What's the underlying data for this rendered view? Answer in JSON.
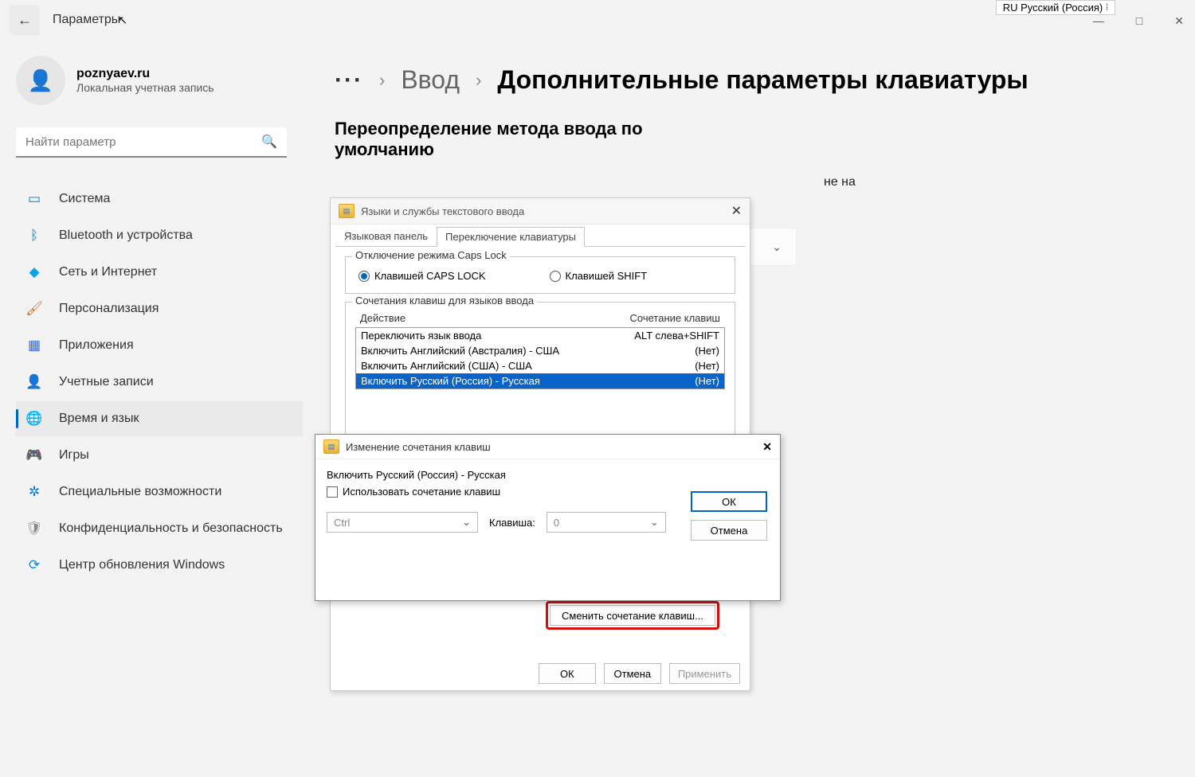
{
  "window": {
    "title": "Параметры",
    "langIndicator": "RU Русский (Россия)"
  },
  "account": {
    "name": "poznyaev.ru",
    "sub": "Локальная учетная запись"
  },
  "search": {
    "placeholder": "Найти параметр"
  },
  "nav": {
    "system": "Система",
    "bluetooth": "Bluetooth и устройства",
    "network": "Сеть и Интернет",
    "personalization": "Персонализация",
    "apps": "Приложения",
    "accounts": "Учетные записи",
    "timeLanguage": "Время и язык",
    "gaming": "Игры",
    "accessibility": "Специальные возможности",
    "privacy": "Конфиденциальность и безопасность",
    "update": "Центр обновления Windows"
  },
  "breadcrumb": {
    "dots": "···",
    "sep": "›",
    "input": "Ввод",
    "current": "Дополнительные параметры клавиатуры"
  },
  "section": {
    "title": "Переопределение метода ввода по умолчанию"
  },
  "bgText": {
    "neNa": "не на"
  },
  "dialog1": {
    "title": "Языки и службы текстового ввода",
    "tabs": {
      "bar": "Языковая панель",
      "switch": "Переключение клавиатуры"
    },
    "capsGroup": "Отключение режима Caps Lock",
    "capsOpt1": "Клавишей CAPS LOCK",
    "capsOpt2": "Клавишей SHIFT",
    "hkGroup": "Сочетания клавиш для языков ввода",
    "colAction": "Действие",
    "colHotkey": "Сочетание клавиш",
    "rows": {
      "r0a": "Переключить язык ввода",
      "r0b": "ALT слева+SHIFT",
      "r1a": "Включить Английский (Австралия) - США",
      "r1b": "(Нет)",
      "r2a": "Включить Английский (США) - США",
      "r2b": "(Нет)",
      "r3a": "Включить Русский (Россия) - Русская",
      "r3b": "(Нет)"
    },
    "changeBtn": "Сменить сочетание клавиш...",
    "ok": "ОК",
    "cancel": "Отмена",
    "apply": "Применить"
  },
  "dialog2": {
    "title": "Изменение сочетания клавиш",
    "line1": "Включить Русский (Россия) - Русская",
    "useHotkey": "Использовать сочетание клавиш",
    "comboModLabel": "Ctrl",
    "keyLabel": "Клавиша:",
    "keyValue": "0",
    "ok": "ОК",
    "cancel": "Отмена"
  }
}
